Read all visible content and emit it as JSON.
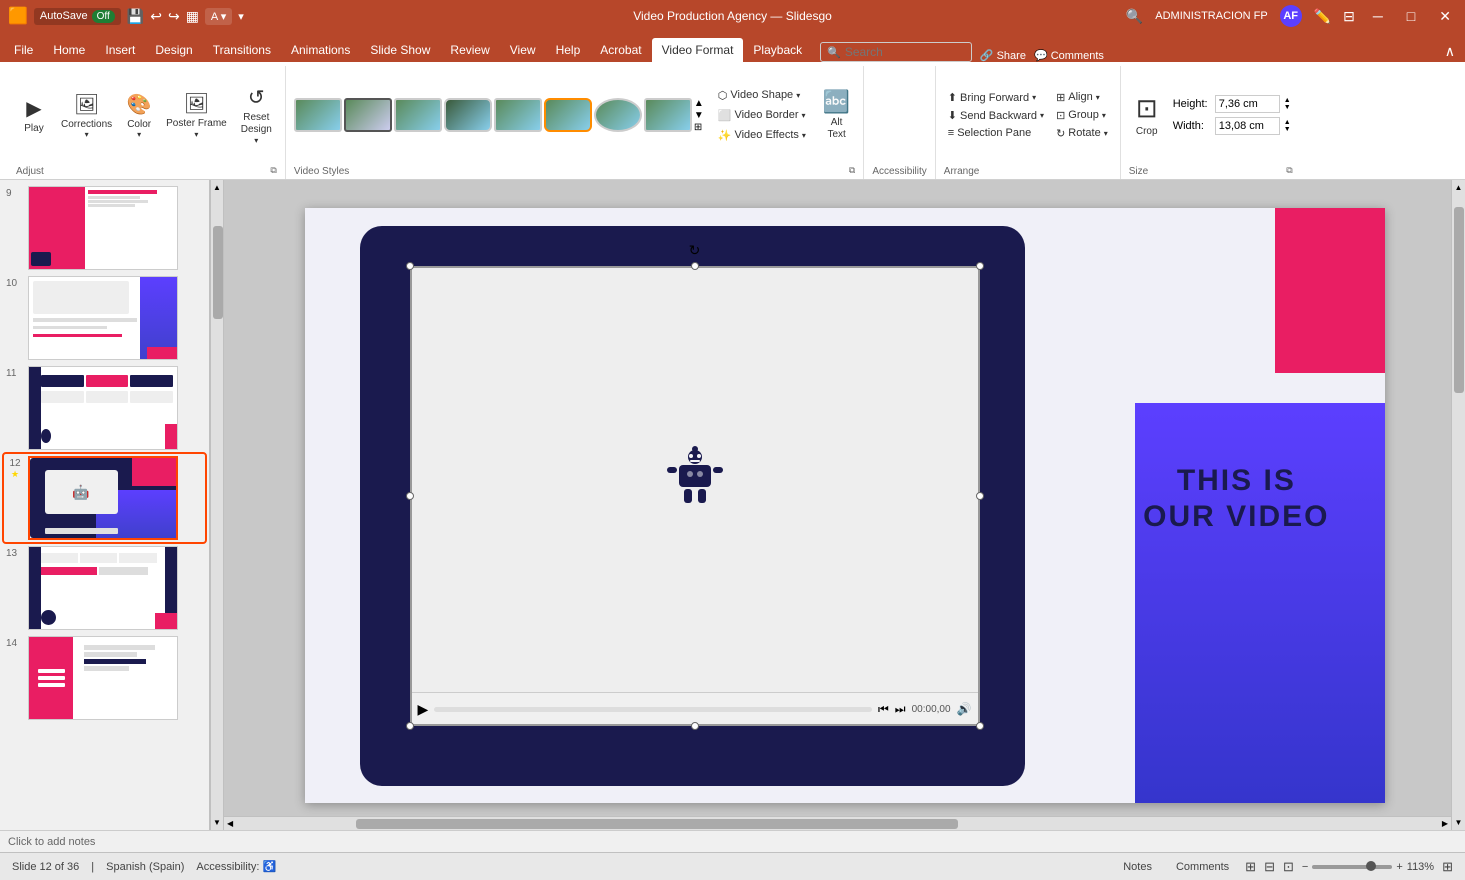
{
  "titlebar": {
    "autosave_label": "AutoSave",
    "autosave_state": "Off",
    "title": "Video Production Agency — Slidesgo",
    "user": "ADMINISTRACION FP",
    "undo_tip": "Undo",
    "redo_tip": "Redo",
    "save_label": "Save"
  },
  "menubar": {
    "items": [
      {
        "label": "File"
      },
      {
        "label": "Home"
      },
      {
        "label": "Insert"
      },
      {
        "label": "Design"
      },
      {
        "label": "Transitions"
      },
      {
        "label": "Animations"
      },
      {
        "label": "Slide Show"
      },
      {
        "label": "Review"
      },
      {
        "label": "View"
      },
      {
        "label": "Help"
      },
      {
        "label": "Acrobat"
      },
      {
        "label": "Video Format",
        "active": true
      },
      {
        "label": "Playback"
      }
    ],
    "search_placeholder": "Search"
  },
  "ribbon": {
    "groups": {
      "adjust": {
        "label": "Adjust",
        "play_label": "Play",
        "corrections_label": "Corrections",
        "color_label": "Color",
        "poster_frame_label": "Poster Frame",
        "reset_design_label": "Reset Design"
      },
      "video_styles": {
        "label": "Video Styles",
        "video_shape_label": "Video Shape",
        "video_border_label": "Video Border",
        "video_effects_label": "Video Effects",
        "alt_text_label": "Alt Text"
      },
      "accessibility": {
        "label": "Accessibility"
      },
      "arrange": {
        "label": "Arrange",
        "bring_forward_label": "Bring Forward",
        "send_backward_label": "Send Backward",
        "selection_pane_label": "Selection Pane",
        "align_label": "Align",
        "group_label": "Group",
        "rotate_label": "Rotate"
      },
      "size": {
        "label": "Size",
        "crop_label": "Crop",
        "height_label": "Height:",
        "height_value": "7,36 cm",
        "width_label": "Width:",
        "width_value": "13,08 cm"
      }
    },
    "tabs": [
      {
        "label": "File"
      },
      {
        "label": "Home"
      },
      {
        "label": "Insert"
      },
      {
        "label": "Design"
      },
      {
        "label": "Transitions"
      },
      {
        "label": "Animations"
      },
      {
        "label": "Slide Show"
      },
      {
        "label": "Review"
      },
      {
        "label": "View"
      },
      {
        "label": "Help"
      },
      {
        "label": "Acrobat"
      },
      {
        "label": "Video Format",
        "active": true
      },
      {
        "label": "Playback"
      }
    ]
  },
  "slides": [
    {
      "number": "9",
      "active": false
    },
    {
      "number": "10",
      "active": false
    },
    {
      "number": "11",
      "active": false
    },
    {
      "number": "12",
      "active": true,
      "starred": true
    },
    {
      "number": "13",
      "active": false
    },
    {
      "number": "14",
      "active": false
    }
  ],
  "slide": {
    "video_text": "THIS IS\nOUR VIDEO",
    "time_display": "00:00,00",
    "notes_placeholder": "Click to add notes"
  },
  "statusbar": {
    "slide_info": "Slide 12 of 36",
    "language": "Spanish (Spain)",
    "accessibility_label": "Accessibility:",
    "notes_label": "Notes",
    "comments_label": "Comments",
    "zoom_label": "113%",
    "zoom_fit_label": "Fit"
  }
}
